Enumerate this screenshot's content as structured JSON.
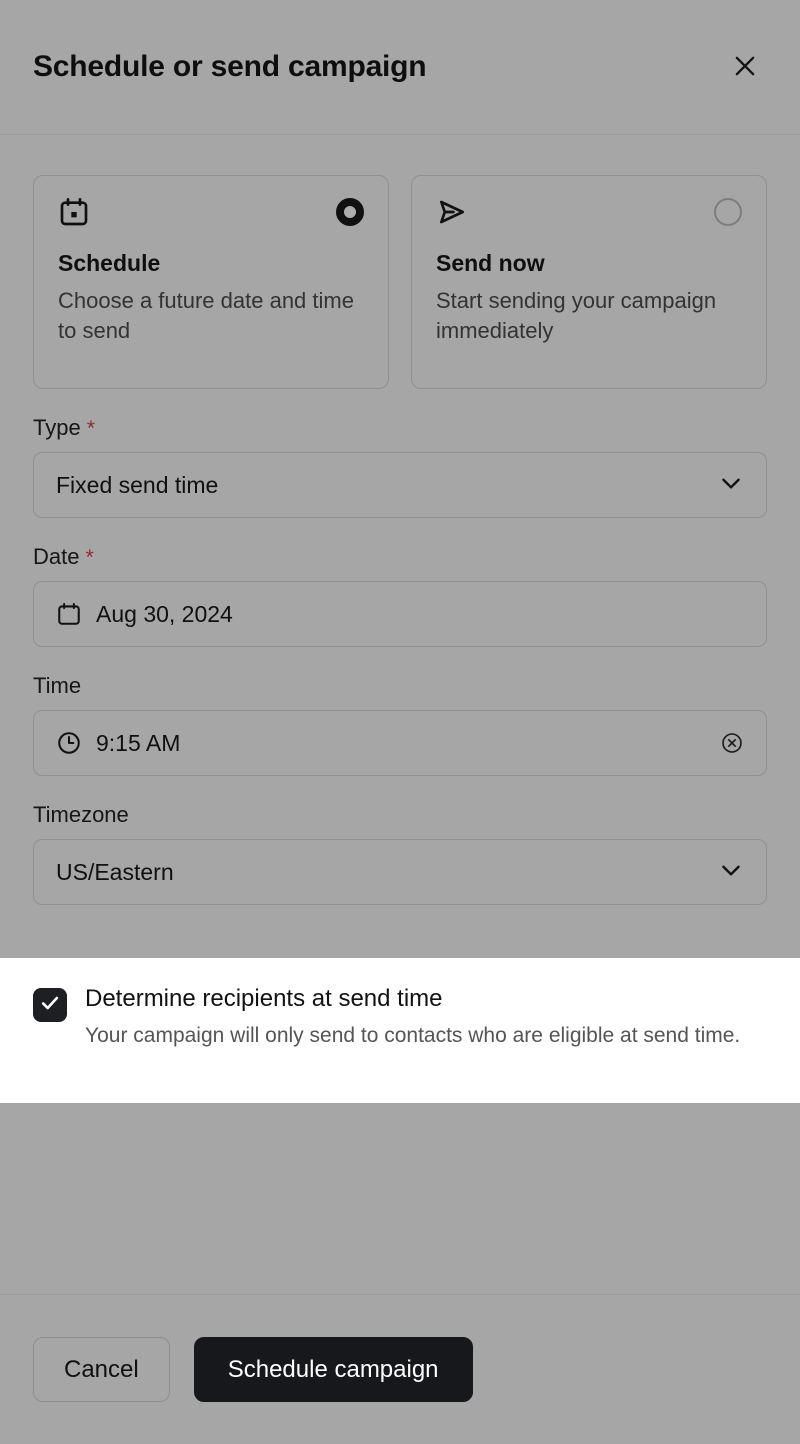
{
  "header": {
    "title": "Schedule or send campaign",
    "close_icon": "close-icon"
  },
  "options": [
    {
      "icon": "calendar-icon",
      "title": "Schedule",
      "description": "Choose a future date and time to send",
      "selected": true
    },
    {
      "icon": "send-icon",
      "title": "Send now",
      "description": "Start sending your campaign immediately",
      "selected": false
    }
  ],
  "fields": {
    "type": {
      "label": "Type",
      "required_marker": "*",
      "value": "Fixed send time",
      "chevron_icon": "chevron-down-icon"
    },
    "date": {
      "label": "Date",
      "required_marker": "*",
      "value": "Aug 30, 2024",
      "leading_icon": "calendar-icon"
    },
    "time": {
      "label": "Time",
      "value": "9:15 AM",
      "leading_icon": "clock-icon",
      "clear_icon": "circle-x-icon"
    },
    "timezone": {
      "label": "Timezone",
      "value": "US/Eastern",
      "chevron_icon": "chevron-down-icon"
    }
  },
  "recipients_option": {
    "checked": true,
    "checkbox_icon": "checkmark-icon",
    "title": "Determine recipients at send time",
    "description": "Your campaign will only send to contacts who are eligible at send time."
  },
  "footer": {
    "cancel_label": "Cancel",
    "submit_label": "Schedule campaign"
  },
  "colors": {
    "surface": "#a6a6a6",
    "highlight_surface": "#ffffff",
    "primary_button": "#16181b",
    "required_asterisk": "#8d2b34",
    "text": "#101010"
  }
}
